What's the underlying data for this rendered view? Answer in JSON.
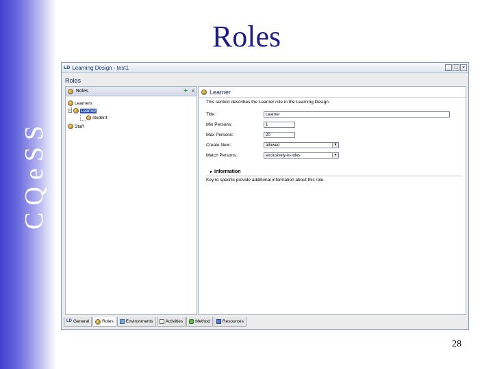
{
  "slide": {
    "side_label": "CQeSS",
    "title": "Roles",
    "page_number": "28"
  },
  "window": {
    "logo": "LD",
    "title": "Learning Design - test1",
    "controls": [
      "_",
      "□",
      "×"
    ]
  },
  "section_label": "Roles",
  "left_panel": {
    "header_title": "Roles",
    "add_label": "+",
    "delete_label": "×",
    "tree": [
      {
        "label": "Learners"
      },
      {
        "label": "Learner",
        "selected": true
      },
      {
        "label": "student"
      },
      {
        "label": "Staff"
      }
    ]
  },
  "right_panel": {
    "header_title": "Learner",
    "description": "This section describes the Learner role in the Learning Design.",
    "fields": [
      {
        "label": "Title:",
        "value": "Learner",
        "type": "text"
      },
      {
        "label": "Min Persons:",
        "value": "1",
        "type": "text"
      },
      {
        "label": "Max Persons:",
        "value": "20",
        "type": "text"
      },
      {
        "label": "Create New:",
        "value": "allowed",
        "type": "select"
      },
      {
        "label": "Match Persons:",
        "value": "exclusively-in-roles",
        "type": "select"
      }
    ],
    "information": {
      "label": "Information",
      "text": "Key to specific provide additional information about this role."
    }
  },
  "bottom_tabs": [
    {
      "label": "General",
      "icon": "ld-logo-icon"
    },
    {
      "label": "Roles",
      "icon": "role-icon",
      "active": true
    },
    {
      "label": "Environments",
      "icon": "environment-icon"
    },
    {
      "label": "Activities",
      "icon": "activity-icon"
    },
    {
      "label": "Method",
      "icon": "method-icon"
    },
    {
      "label": "Resources",
      "icon": "resources-icon"
    }
  ]
}
